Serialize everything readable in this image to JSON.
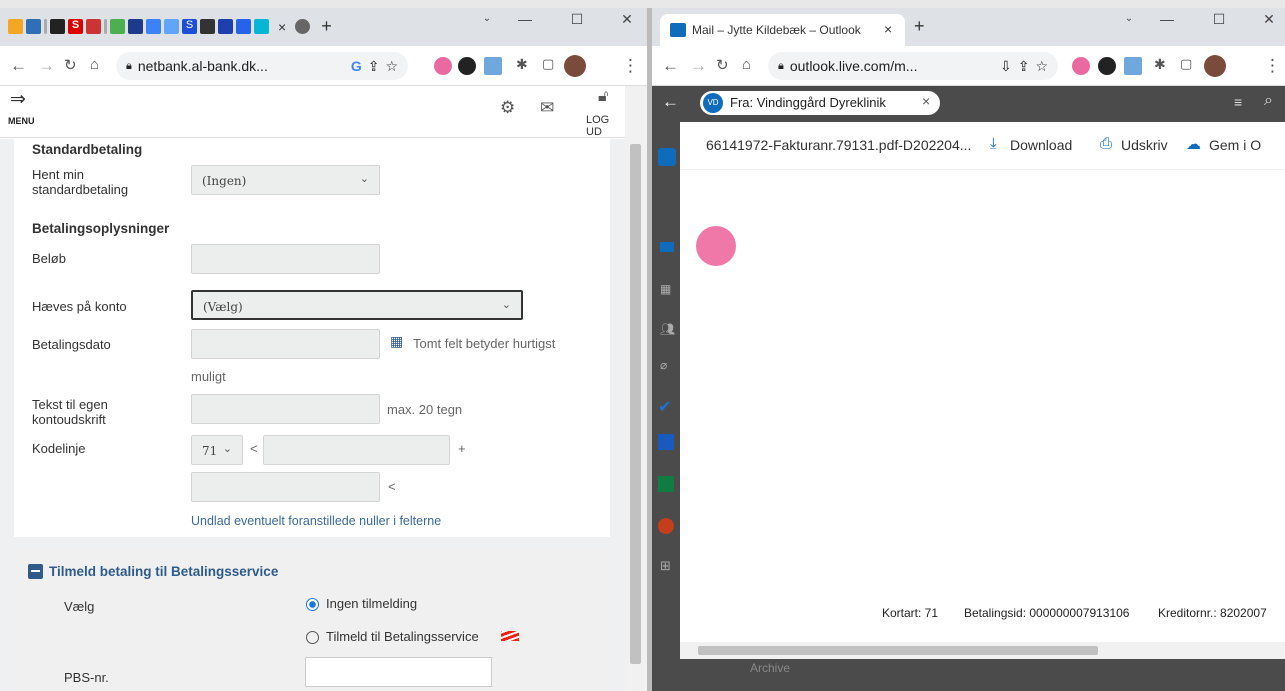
{
  "left_browser": {
    "tab_close": "×",
    "new_tab": "+",
    "url": "netbank.al-bank.dk...",
    "favicon_letters": [
      "S",
      "S"
    ]
  },
  "bank": {
    "menu_label": "MENU",
    "logout_label": "LOG UD",
    "standard_title": "Standardbetaling",
    "hent_label": "Hent min standardbetaling",
    "hent_value": "(Ingen)",
    "payinfo_title": "Betalingsoplysninger",
    "amount_label": "Beløb",
    "account_label": "Hæves på konto",
    "account_value": "(Vælg)",
    "date_label": "Betalingsdato",
    "date_hint": "Tomt felt betyder hurtigst",
    "date_hint2": "muligt",
    "text_label": "Tekst til egen kontoudskrift",
    "text_hint": "max. 20 tegn",
    "code_label": "Kodelinje",
    "code_type": "71",
    "lt1": "<",
    "plus": "+",
    "lt2": "<",
    "zeros_hint": "Undlad eventuelt foranstillede nuller i felterne",
    "bs_title": "Tilmeld betaling til Betalingsservice",
    "choose_label": "Vælg",
    "opt_none": "Ingen tilmelding",
    "opt_signup": "Tilmeld til Betalingsservice",
    "pbs_label": "PBS-nr."
  },
  "right_browser": {
    "tab_title": "Mail – Jytte Kildebæk – Outlook",
    "tab_close": "×",
    "new_tab": "+",
    "url": "outlook.live.com/m..."
  },
  "outlook": {
    "avatar": "VD",
    "from_label": "Fra: Vindinggård Dyreklinik",
    "chip_close": "×",
    "file_name": "66141972-Fakturanr.79131.pdf-D202204...",
    "download": "Download",
    "print": "Udskriv",
    "save": "Gem i O",
    "footer_kortart": "Kortart: 71",
    "footer_betalingsid": "Betalingsid: 000000007913106",
    "footer_kreditor": "Kreditornr.: 8202007",
    "behind_text": "Archive"
  },
  "colors": {
    "accent": "#1a73e8",
    "bank_blue": "#2e5b8a",
    "outlook_dark": "#4b4b4b",
    "link_blue": "#3a6a9a"
  }
}
